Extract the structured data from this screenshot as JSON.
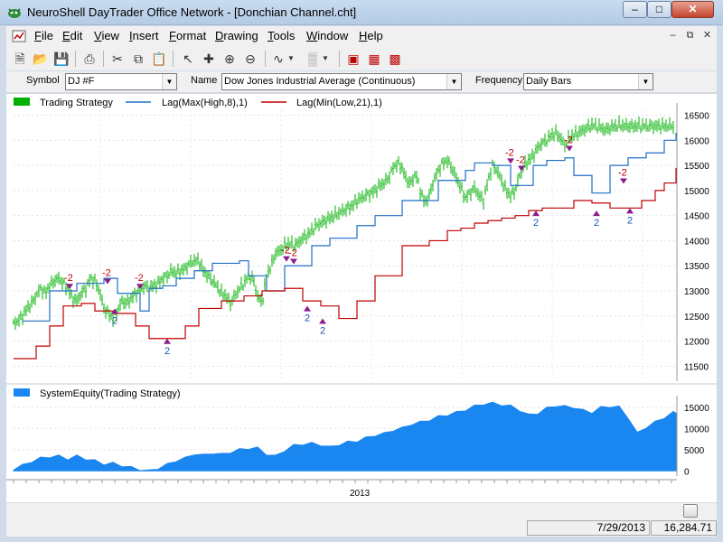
{
  "window": {
    "title": "NeuroShell DayTrader Office Network - [Donchian Channel.cht]",
    "min_label": "–",
    "max_label": "□",
    "close_label": "✕"
  },
  "menubar": {
    "items": [
      "File",
      "Edit",
      "View",
      "Insert",
      "Format",
      "Drawing",
      "Tools",
      "Window",
      "Help"
    ],
    "mdi_min": "–",
    "mdi_restore": "⧉",
    "mdi_close": "✕"
  },
  "toolbar": {
    "icons": [
      "new-icon",
      "open-icon",
      "save-icon",
      "print-icon",
      "cut-icon",
      "copy-icon",
      "paste-icon",
      "pointer-icon",
      "crosshair-icon",
      "zoom-in-icon",
      "zoom-out-icon",
      "line-tool-icon",
      "pattern-icon",
      "chart-window-icon",
      "chart-wizard-icon",
      "trade-icon"
    ]
  },
  "symbolbar": {
    "symbol_label": "Symbol",
    "symbol_value": "DJ #F",
    "name_label": "Name",
    "name_value": "Dow Jones Industrial Average (Continuous)",
    "frequency_label": "Frequency",
    "frequency_value": "Daily Bars"
  },
  "colors": {
    "bars": "#00b000",
    "upper_channel": "#1f6fc5",
    "lower_channel": "#c00000",
    "equity": "#1a86f0",
    "marker": "#8b1c8b",
    "background": "#ffffff"
  },
  "chart_data": [
    {
      "type": "line",
      "legend": [
        "Trading Strategy",
        "Lag(Max(High,8),1)",
        "Lag(Min(Low,21),1)"
      ],
      "ylim": [
        11200,
        16600
      ],
      "y_ticks": [
        11500,
        12000,
        12500,
        13000,
        13500,
        14000,
        14500,
        15000,
        15500,
        16000,
        16500
      ],
      "grid": true,
      "price_x": [
        0,
        5,
        10,
        15,
        20,
        25,
        30,
        35,
        40,
        45,
        50,
        55,
        60,
        65,
        70,
        75,
        80,
        85,
        90,
        95,
        100,
        105,
        110,
        115,
        120,
        125,
        130,
        135,
        140,
        145,
        150,
        155,
        160,
        165,
        170,
        175,
        180,
        185,
        190,
        195,
        200,
        205,
        210,
        215,
        220,
        225,
        230,
        235,
        240,
        245,
        250,
        255,
        260,
        265,
        270,
        275,
        280,
        285,
        290,
        295,
        300,
        305,
        310,
        315,
        320,
        325,
        330,
        335,
        340,
        345,
        350,
        355,
        360,
        365,
        370,
        375,
        380,
        385,
        390,
        395,
        400,
        405,
        410,
        415,
        420,
        425,
        430,
        435,
        440,
        445,
        450,
        455,
        460,
        465,
        470,
        475,
        480,
        485,
        490,
        495,
        500,
        505,
        510,
        515,
        520,
        525,
        530,
        535,
        540,
        545,
        550,
        555,
        560,
        565,
        570,
        575,
        580,
        585,
        590,
        595,
        600,
        605,
        610,
        615,
        620,
        625,
        630,
        635,
        640,
        645,
        650,
        655,
        660,
        665,
        670,
        675,
        680,
        685,
        690,
        695,
        700,
        705,
        710,
        715,
        720,
        725,
        730
      ],
      "price_y": [
        12350,
        12400,
        12500,
        12650,
        12750,
        12900,
        13050,
        12950,
        13100,
        13200,
        13250,
        13150,
        13050,
        12850,
        12800,
        12950,
        13050,
        13250,
        13200,
        13000,
        12650,
        12550,
        12450,
        12600,
        12800,
        12750,
        12850,
        12950,
        13000,
        13100,
        13050,
        13100,
        13150,
        13250,
        13300,
        13400,
        13350,
        13400,
        13450,
        13550,
        13600,
        13600,
        13400,
        13300,
        13200,
        13100,
        12950,
        12900,
        12750,
        12900,
        13050,
        13150,
        13300,
        13250,
        12900,
        12750,
        13300,
        13500,
        13750,
        13800,
        13900,
        13950,
        13900,
        13950,
        14050,
        14100,
        14200,
        14300,
        14350,
        14400,
        14450,
        14500,
        14550,
        14600,
        14650,
        14700,
        14800,
        14850,
        14900,
        14950,
        15000,
        15100,
        15150,
        15250,
        15450,
        15550,
        15450,
        15200,
        15150,
        15350,
        15000,
        14750,
        14900,
        15200,
        15400,
        15550,
        15600,
        15450,
        15250,
        15050,
        14850,
        14950,
        15050,
        14900,
        14800,
        15200,
        15500,
        15400,
        15200,
        15000,
        14900,
        15000,
        15300,
        15500,
        15600,
        15700,
        15850,
        15950,
        16000,
        16100,
        16150,
        16050,
        15900,
        16050,
        16100,
        16150,
        16200,
        16250,
        16300,
        16280,
        16250,
        16200,
        16250,
        16280,
        16300,
        16285,
        16284,
        16280,
        16285,
        16284,
        16284,
        16284,
        16284,
        16284,
        16284,
        16284,
        16284
      ],
      "upper_x": [
        10,
        40,
        70,
        100,
        115,
        140,
        150,
        165,
        180,
        200,
        220,
        250,
        260,
        280,
        300,
        330,
        350,
        380,
        400,
        430,
        470,
        500,
        510,
        530,
        550,
        575,
        590,
        610,
        620,
        640,
        660,
        680,
        700,
        720,
        733
      ],
      "upper_y": [
        12400,
        13000,
        13150,
        13250,
        12950,
        12600,
        13050,
        13100,
        13250,
        13400,
        13550,
        13600,
        13300,
        13000,
        13500,
        13900,
        14050,
        14300,
        14500,
        14800,
        15200,
        15400,
        15550,
        15500,
        15100,
        15500,
        15600,
        15650,
        15300,
        14950,
        15500,
        15650,
        15750,
        16000,
        16150
      ],
      "lower_x": [
        0,
        15,
        25,
        40,
        55,
        75,
        90,
        110,
        135,
        150,
        170,
        190,
        205,
        230,
        255,
        275,
        300,
        320,
        340,
        360,
        380,
        400,
        430,
        460,
        480,
        495,
        510,
        525,
        540,
        555,
        570,
        585,
        600,
        620,
        640,
        660,
        680,
        695,
        710,
        720,
        733
      ],
      "lower_y": [
        11650,
        11650,
        11900,
        12300,
        12700,
        12750,
        12600,
        12550,
        12300,
        12050,
        12050,
        12300,
        12650,
        12800,
        12900,
        13000,
        13050,
        12800,
        12700,
        12450,
        12800,
        13300,
        13900,
        14000,
        14200,
        14250,
        14350,
        14400,
        14450,
        14500,
        14600,
        14650,
        14650,
        14800,
        14750,
        14650,
        14650,
        14800,
        15000,
        15150,
        15450
      ],
      "signals": [
        {
          "x": 62,
          "y": 13050,
          "label": "-2"
        },
        {
          "x": 104,
          "y": 13150,
          "label": "-2"
        },
        {
          "x": 140,
          "y": 13050,
          "label": "-2"
        },
        {
          "x": 112,
          "y": 12650,
          "label": "2"
        },
        {
          "x": 170,
          "y": 12050,
          "label": "2"
        },
        {
          "x": 302,
          "y": 13600,
          "label": "-2"
        },
        {
          "x": 310,
          "y": 13550,
          "label": "-2"
        },
        {
          "x": 325,
          "y": 12700,
          "label": "2"
        },
        {
          "x": 342,
          "y": 12450,
          "label": "2"
        },
        {
          "x": 550,
          "y": 15550,
          "label": "-2"
        },
        {
          "x": 562,
          "y": 15400,
          "label": "-2"
        },
        {
          "x": 578,
          "y": 14600,
          "label": "2"
        },
        {
          "x": 615,
          "y": 15800,
          "label": "-2"
        },
        {
          "x": 645,
          "y": 14600,
          "label": "2"
        },
        {
          "x": 675,
          "y": 15150,
          "label": "-2"
        },
        {
          "x": 682,
          "y": 14650,
          "label": "2"
        }
      ]
    },
    {
      "type": "area",
      "legend": [
        "SystemEquity(Trading Strategy)"
      ],
      "ylim": [
        -800,
        16500
      ],
      "y_ticks": [
        0,
        5000,
        10000,
        15000
      ],
      "x_tick_label": "2013",
      "grid": true,
      "x": [
        0,
        10,
        20,
        30,
        40,
        50,
        60,
        70,
        80,
        90,
        100,
        110,
        120,
        130,
        140,
        150,
        160,
        170,
        180,
        190,
        200,
        210,
        220,
        230,
        240,
        250,
        260,
        270,
        280,
        290,
        300,
        310,
        320,
        330,
        340,
        350,
        360,
        370,
        380,
        390,
        400,
        410,
        420,
        430,
        440,
        450,
        460,
        470,
        480,
        490,
        500,
        510,
        520,
        530,
        540,
        550,
        560,
        570,
        580,
        590,
        600,
        610,
        620,
        630,
        640,
        650,
        660,
        670,
        680,
        690,
        700,
        710,
        720,
        730,
        733
      ],
      "values": [
        400,
        1300,
        2200,
        3000,
        3300,
        3500,
        2800,
        3500,
        2800,
        2400,
        1600,
        1800,
        1200,
        800,
        300,
        0,
        600,
        1500,
        2400,
        3000,
        4000,
        3700,
        4200,
        3900,
        4400,
        5000,
        5300,
        5400,
        3900,
        3500,
        4800,
        6000,
        6300,
        6500,
        6100,
        5600,
        6200,
        6800,
        7000,
        7800,
        8400,
        8800,
        9600,
        10100,
        11000,
        11500,
        12000,
        12800,
        13200,
        13800,
        14400,
        15300,
        15800,
        16000,
        15600,
        15300,
        14300,
        13200,
        13600,
        14800,
        15400,
        15200,
        15000,
        14300,
        13800,
        15000,
        15200,
        15100,
        12600,
        8900,
        10300,
        11500,
        12600,
        13800,
        13900
      ]
    }
  ],
  "x_axis": {
    "label": "2013"
  },
  "statusbar": {
    "date": "7/29/2013",
    "value": "16,284.71"
  }
}
